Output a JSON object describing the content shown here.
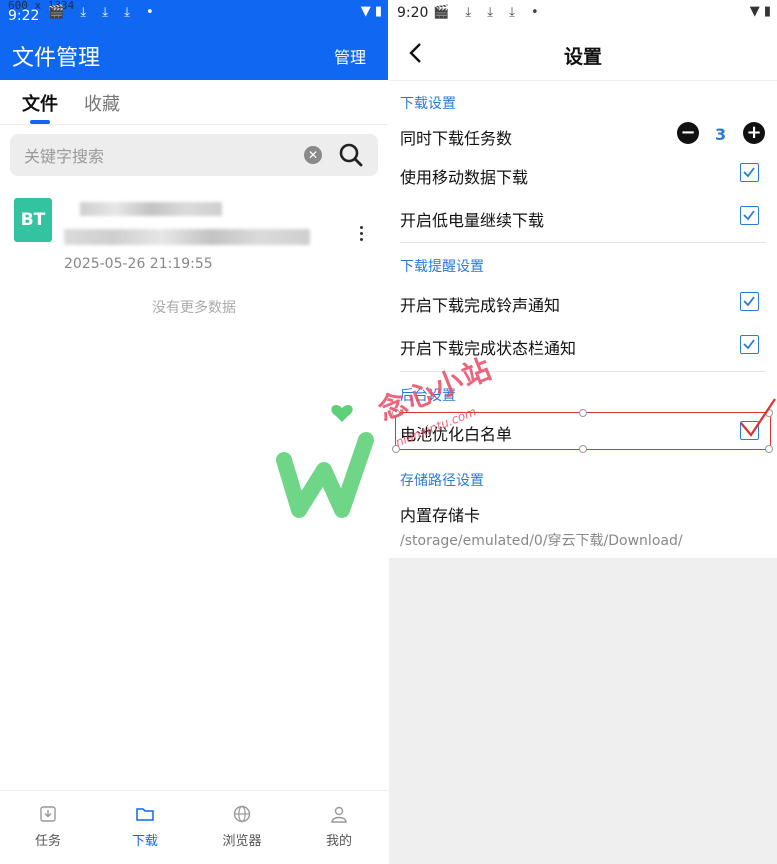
{
  "left": {
    "status_bar": {
      "time": "9:22",
      "icons": "🎬 ⤓ ⤓ ⤓ •",
      "right": "▼ ▮"
    },
    "overlay": "600 x 1334",
    "title": "文件管理",
    "manage_label": "管理",
    "tabs": [
      {
        "label": "文件"
      },
      {
        "label": "收藏"
      }
    ],
    "search": {
      "placeholder": "关键字搜索"
    },
    "file": {
      "badge": "BT",
      "date": "2025-05-26 21:19:55"
    },
    "no_more": "没有更多数据",
    "nav": [
      {
        "label": "任务",
        "icon": "download-tray-icon"
      },
      {
        "label": "下载",
        "icon": "folder-icon"
      },
      {
        "label": "浏览器",
        "icon": "globe-icon"
      },
      {
        "label": "我的",
        "icon": "user-icon"
      }
    ],
    "colors": {
      "primary": "#1067f2",
      "file_icon": "#33c3a0"
    }
  },
  "right": {
    "status_bar": {
      "time": "9:20",
      "icons": "🎬 ⤓ ⤓ ⤓ •",
      "right": "▼ ▮"
    },
    "title": "设置",
    "sections": [
      {
        "title": "下载设置",
        "rows": [
          {
            "label": "同时下载任务数",
            "value": "3",
            "type": "stepper"
          },
          {
            "label": "使用移动数据下载",
            "checked": true
          },
          {
            "label": "开启低电量继续下载",
            "checked": true
          }
        ]
      },
      {
        "title": "下载提醒设置",
        "rows": [
          {
            "label": "开启下载完成铃声通知",
            "checked": true
          },
          {
            "label": "开启下载完成状态栏通知",
            "checked": true
          }
        ]
      },
      {
        "title": "后台设置",
        "rows": [
          {
            "label": "电池优化白名单",
            "checked": false
          }
        ]
      },
      {
        "title": "存储路径设置",
        "rows": [
          {
            "label": "内置存储卡",
            "path": "/storage/emulated/0/穿云下载/Download/"
          }
        ]
      }
    ],
    "watermark": {
      "text": "念心小站",
      "sub": "nianxintu.com"
    },
    "colors": {
      "accent": "#2a7bd6",
      "annotation": "#dd3333"
    }
  }
}
